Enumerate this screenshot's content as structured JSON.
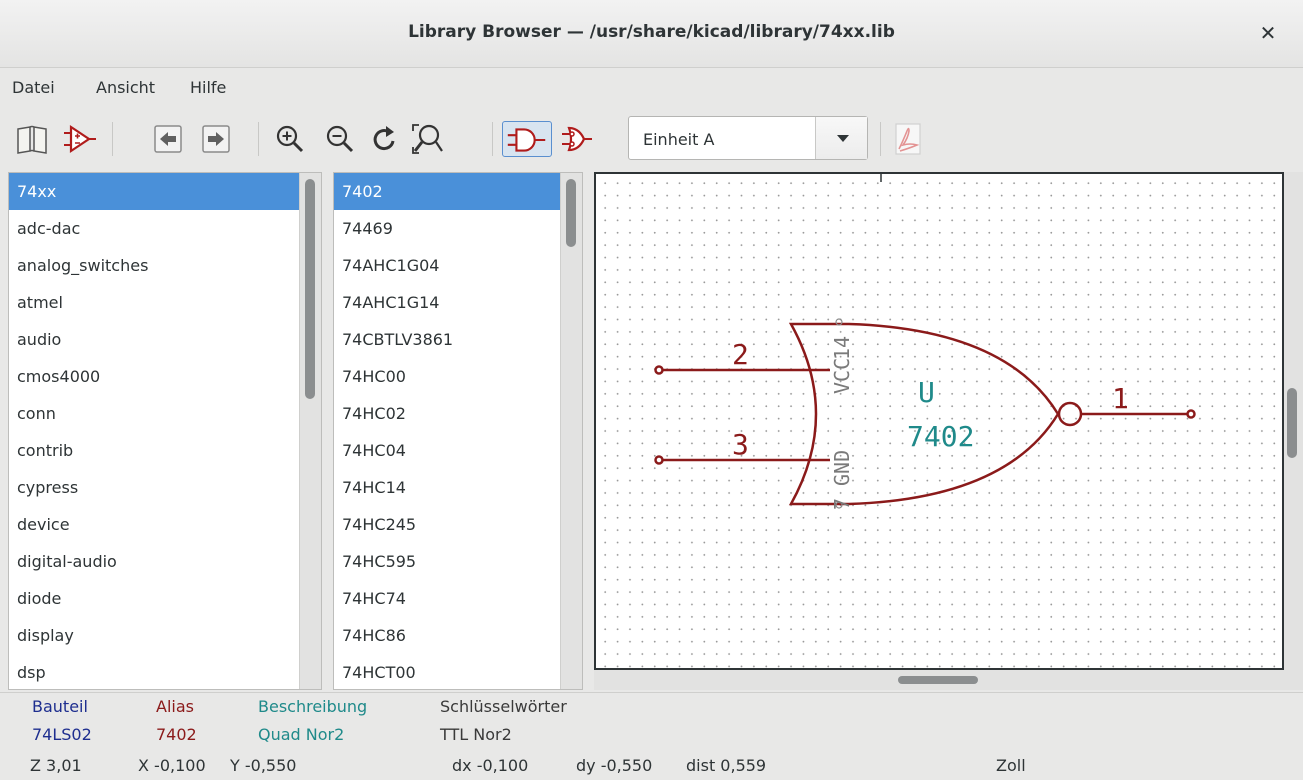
{
  "window": {
    "title": "Library Browser — /usr/share/kicad/library/74xx.lib"
  },
  "menu": [
    "Datei",
    "Ansicht",
    "Hilfe"
  ],
  "toolbar": {
    "buttons": [
      "library-icon",
      "component-icon",
      "previous-icon",
      "next-icon",
      "zoom-in-icon",
      "zoom-out-icon",
      "redraw-icon",
      "zoom-fit-icon",
      "body-style-normal-icon",
      "body-style-demorgan-icon",
      "datasheet-pdf-icon"
    ],
    "unit_select": "Einheit A"
  },
  "libraries": {
    "items": [
      "74xx",
      "adc-dac",
      "analog_switches",
      "atmel",
      "audio",
      "cmos4000",
      "conn",
      "contrib",
      "cypress",
      "device",
      "digital-audio",
      "diode",
      "display",
      "dsp"
    ],
    "selected": "74xx"
  },
  "components": {
    "items": [
      "7402",
      "74469",
      "74AHC1G04",
      "74AHC1G14",
      "74CBTLV3861",
      "74HC00",
      "74HC02",
      "74HC04",
      "74HC14",
      "74HC245",
      "74HC595",
      "74HC74",
      "74HC86",
      "74HCT00"
    ],
    "selected": "7402"
  },
  "symbol": {
    "reference": "U",
    "value": "7402",
    "pins": [
      {
        "number": "2",
        "name": ""
      },
      {
        "number": "3",
        "name": ""
      },
      {
        "number": "1",
        "name": ""
      },
      {
        "number": "14",
        "name": "VCC"
      },
      {
        "number": "7",
        "name": "GND"
      }
    ],
    "colors": {
      "body": "#8b1a1a",
      "text": "#1f8a8a",
      "pin_name": "#7a7a7a"
    }
  },
  "info_panel": {
    "columns": [
      {
        "label": "Bauteil",
        "value": "74LS02",
        "color": "#1e2e8f"
      },
      {
        "label": "Alias",
        "value": "7402",
        "color": "#8b1a1a"
      },
      {
        "label": "Beschreibung",
        "value": "Quad Nor2",
        "color": "#1f8a8a"
      },
      {
        "label": "Schlüsselwörter",
        "value": "TTL Nor2",
        "color": "#3a3a3a"
      }
    ]
  },
  "status_bar": {
    "zoom": "Z 3,01",
    "x": "X -0,100",
    "y": "Y -0,550",
    "dx": "dx -0,100",
    "dy": "dy -0,550",
    "dist": "dist 0,559",
    "units": "Zoll"
  }
}
